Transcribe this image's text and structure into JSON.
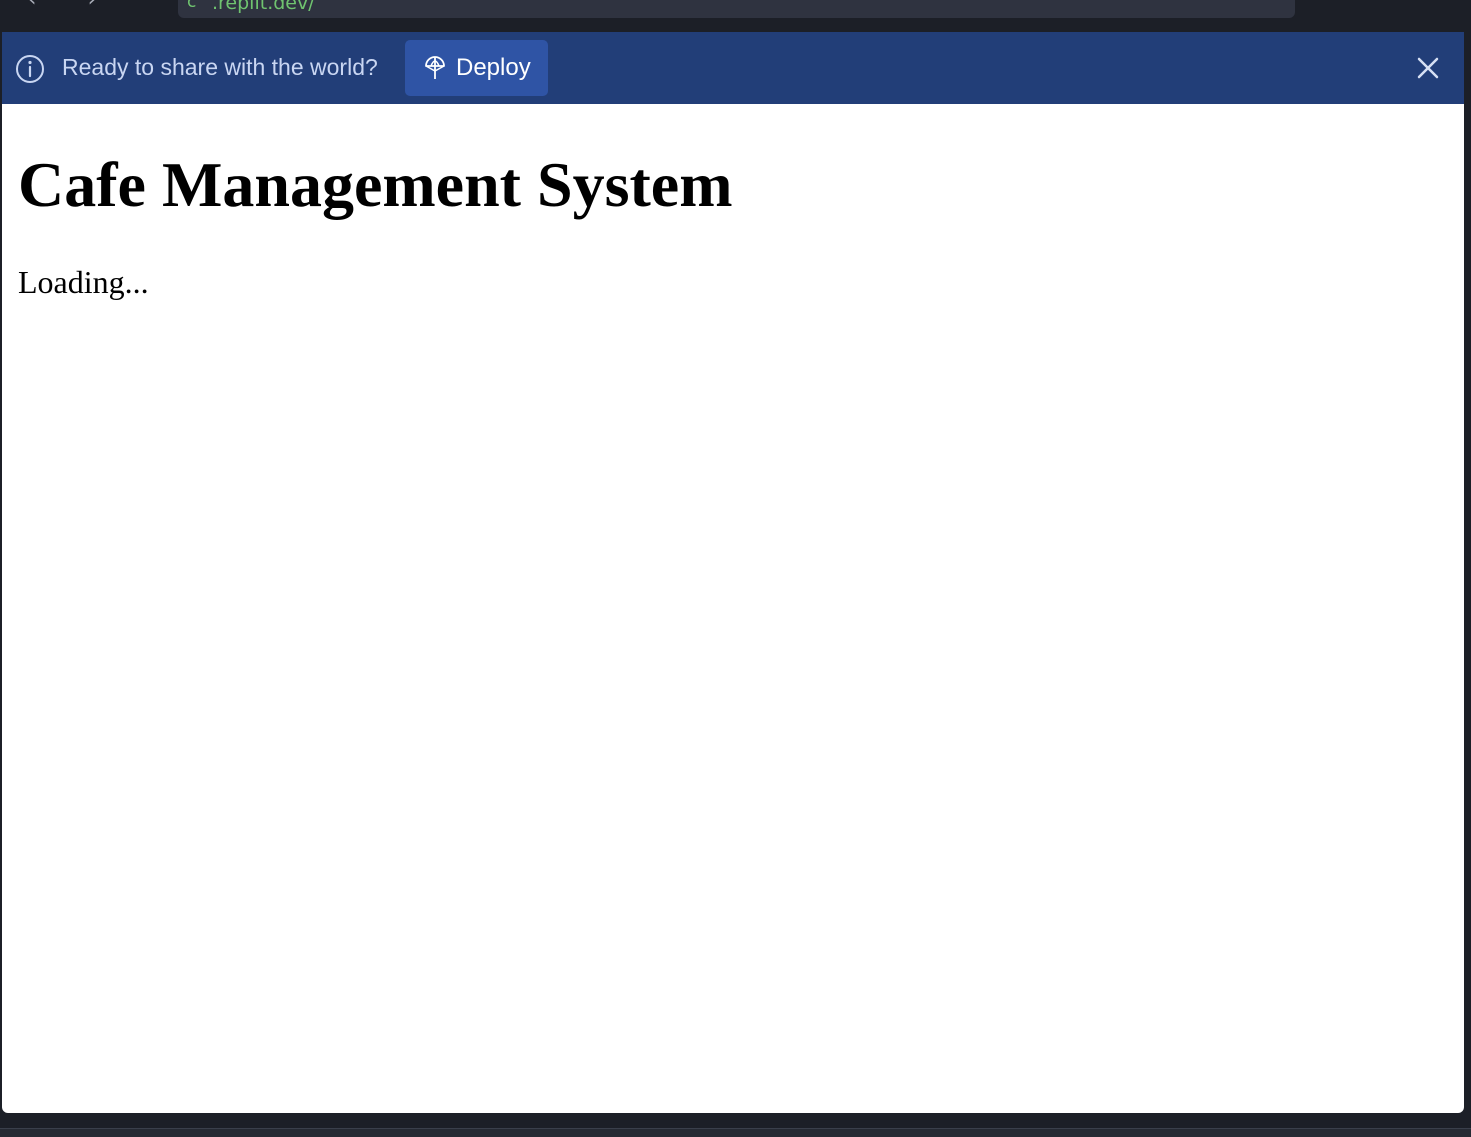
{
  "browser": {
    "url_prefix": "c",
    "url_text": ".replit.dev/",
    "back_icon": "chevron-left-icon",
    "forward_icon": "chevron-right-icon",
    "reload_icon": "reload-icon"
  },
  "banner": {
    "message": "Ready to share with the world?",
    "deploy_label": "Deploy",
    "info_icon": "info-icon",
    "deploy_icon": "deploy-icon",
    "close_icon": "close-icon",
    "background": "#223e78",
    "button_color": "#2f54a5"
  },
  "page": {
    "title": "Cafe Management System",
    "status": "Loading..."
  }
}
